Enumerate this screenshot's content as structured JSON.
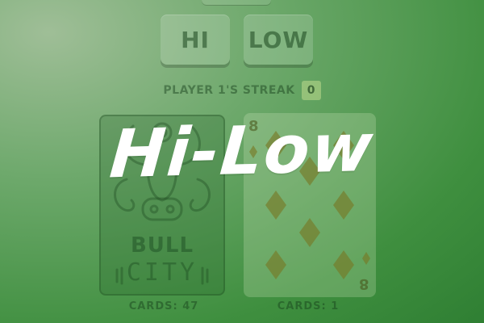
{
  "game": {
    "title": "Hi-Low",
    "buttons": {
      "hi": "HI",
      "low": "LOW"
    },
    "streak": {
      "label": "PLAYER 1'S STREAK",
      "count": "0"
    },
    "deck_logo": {
      "line1": "BULL",
      "line2": "CITY"
    },
    "face_card": {
      "rank": "8",
      "suit": "diamond-icon",
      "suit_color": "#7f7f28"
    },
    "piles": {
      "left": "CARDS: 47",
      "right": "CARDS: 1"
    }
  },
  "colors": {
    "background": "#4a994a",
    "card_face": "#cfe6c0"
  }
}
